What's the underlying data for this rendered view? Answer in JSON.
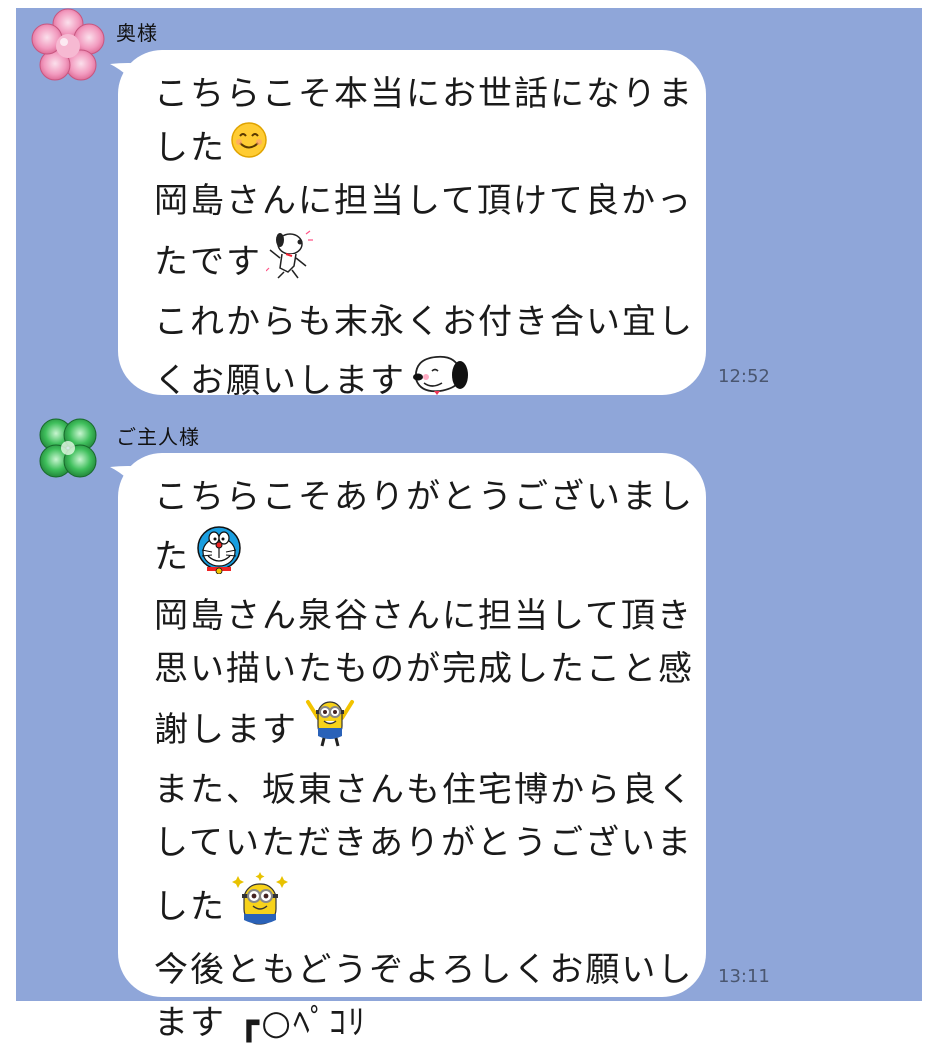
{
  "messages": [
    {
      "sender": "奥様",
      "avatar_icon": "pink-flower-icon",
      "time": "12:52",
      "lines": [
        "こちらこそ本当にお世話になりま",
        "した",
        "岡島さんに担当して頂けて良かっ",
        "たです",
        "これからも末永くお付き合い宜し",
        "くお願いします"
      ]
    },
    {
      "sender": "ご主人様",
      "avatar_icon": "green-clover-icon",
      "time": "13:11",
      "lines": [
        "こちらこそありがとうございまし",
        "た",
        "岡島さん泉谷さんに担当して頂き",
        "思い描いたものが完成したこと感",
        "謝します",
        "また、坂東さんも住宅博から良く",
        "していただきありがとうございま",
        "した",
        "今後ともどうぞよろしくお願いし",
        "ます ┏○ﾍﾟｺﾘ"
      ]
    }
  ],
  "colors": {
    "chat_background": "#8fa6d9",
    "bubble": "#ffffff"
  }
}
